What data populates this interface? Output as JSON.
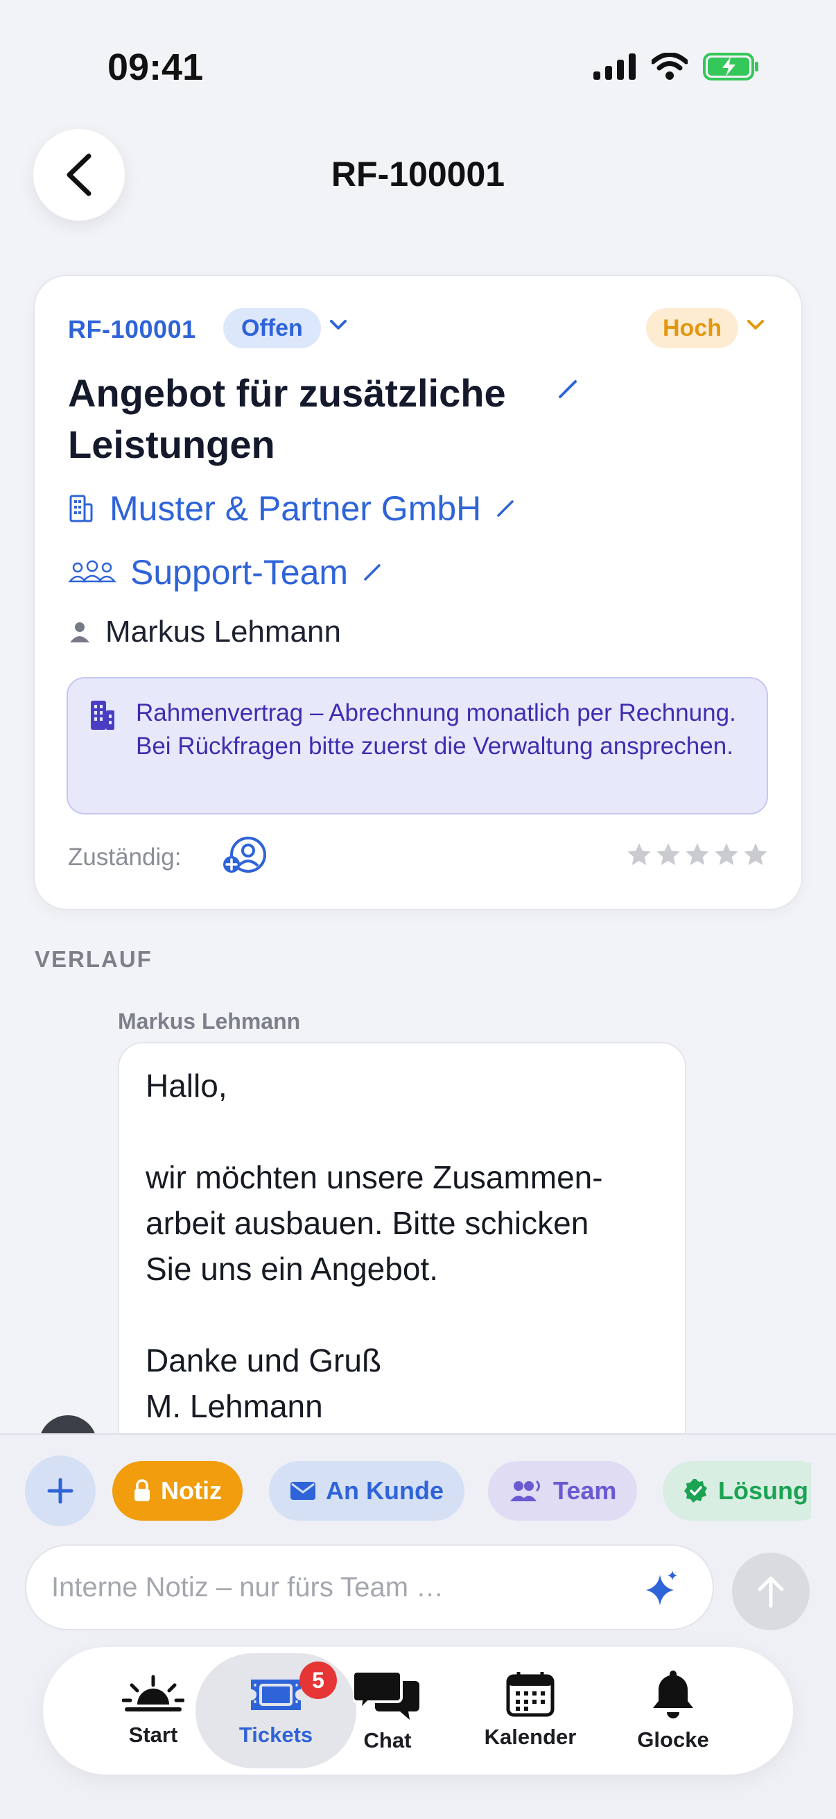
{
  "status_bar": {
    "time": "09:41"
  },
  "header": {
    "title": "RF-100001"
  },
  "ticket": {
    "id": "RF-100001",
    "status": "Offen",
    "priority": "Hoch",
    "subject": "Angebot für zusätzliche Leistungen",
    "company": "Muster & Partner GmbH",
    "team": "Support-Team",
    "contact": "Markus Lehmann",
    "info_note": "Rahmenvertrag – Abrechnung monatlich per Rechnung. Bei Rückfragen bitte zuerst die Verwaltung ansprechen.",
    "assignee_label": "Zuständig:",
    "rating": 0,
    "rating_max": 5
  },
  "timeline": {
    "section_label": "VERLAUF",
    "messages": [
      {
        "author": "Markus Lehmann",
        "body": "Hallo,\n\nwir möchten unsere Zusammen-\narbeit ausbauen. Bitte schicken\nSie uns ein Angebot.\n\nDanke und Gruß\nM. Lehmann"
      }
    ]
  },
  "composer": {
    "modes": [
      {
        "label": "Notiz",
        "icon": "lock-icon",
        "active": true
      },
      {
        "label": "An Kunde",
        "icon": "envelope-icon",
        "active": false
      },
      {
        "label": "Team",
        "icon": "team-icon",
        "active": false
      },
      {
        "label": "Lösung",
        "icon": "check-badge-icon",
        "active": false
      }
    ],
    "placeholder": "Interne Notiz – nur fürs Team …"
  },
  "tab_bar": {
    "tabs": [
      {
        "label": "Start",
        "icon": "sunrise-icon"
      },
      {
        "label": "Tickets",
        "icon": "ticket-icon",
        "badge": "5",
        "active": true
      },
      {
        "label": "Chat",
        "icon": "chat-bubbles-icon"
      },
      {
        "label": "Kalender",
        "icon": "calendar-icon"
      },
      {
        "label": "Glocke",
        "icon": "bell-icon"
      }
    ]
  },
  "colors": {
    "accent_blue": "#2f63d8",
    "priority_orange": "#e39710",
    "note_orange": "#f19d0d",
    "info_purple": "#3b2fb0",
    "solution_green": "#1aa352",
    "badge_red": "#e53535"
  }
}
